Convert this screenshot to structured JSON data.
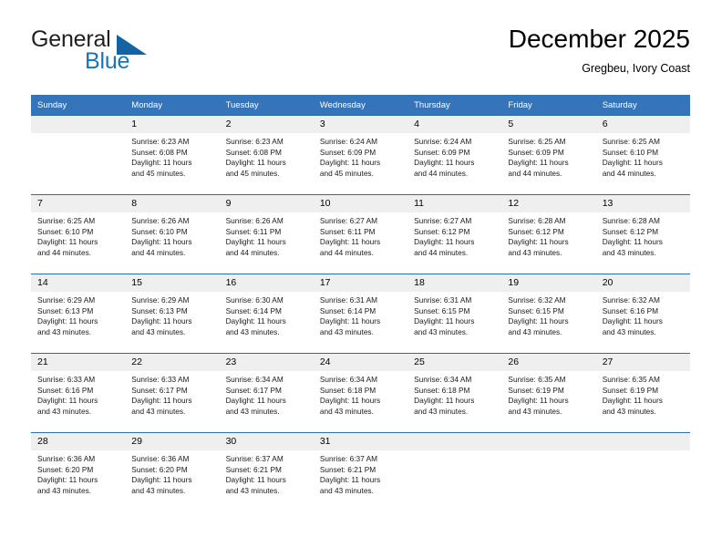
{
  "brand": {
    "name_part1": "General",
    "name_part2": "Blue",
    "accent_color": "#1675bc",
    "triangle_color": "#1464a5"
  },
  "header": {
    "title": "December 2025",
    "subtitle": "Gregbeu, Ivory Coast"
  },
  "theme": {
    "header_row_bg": "#3574b8",
    "daynum_bg": "#efefef",
    "row_divider": "#2e6da8"
  },
  "weekdays": [
    "Sunday",
    "Monday",
    "Tuesday",
    "Wednesday",
    "Thursday",
    "Friday",
    "Saturday"
  ],
  "weeks": [
    [
      {
        "day": "",
        "blank": true,
        "sunrise": "",
        "sunset": "",
        "daylight1": "",
        "daylight2": ""
      },
      {
        "day": "1",
        "blank": false,
        "sunrise": "Sunrise: 6:23 AM",
        "sunset": "Sunset: 6:08 PM",
        "daylight1": "Daylight: 11 hours",
        "daylight2": "and 45 minutes."
      },
      {
        "day": "2",
        "blank": false,
        "sunrise": "Sunrise: 6:23 AM",
        "sunset": "Sunset: 6:08 PM",
        "daylight1": "Daylight: 11 hours",
        "daylight2": "and 45 minutes."
      },
      {
        "day": "3",
        "blank": false,
        "sunrise": "Sunrise: 6:24 AM",
        "sunset": "Sunset: 6:09 PM",
        "daylight1": "Daylight: 11 hours",
        "daylight2": "and 45 minutes."
      },
      {
        "day": "4",
        "blank": false,
        "sunrise": "Sunrise: 6:24 AM",
        "sunset": "Sunset: 6:09 PM",
        "daylight1": "Daylight: 11 hours",
        "daylight2": "and 44 minutes."
      },
      {
        "day": "5",
        "blank": false,
        "sunrise": "Sunrise: 6:25 AM",
        "sunset": "Sunset: 6:09 PM",
        "daylight1": "Daylight: 11 hours",
        "daylight2": "and 44 minutes."
      },
      {
        "day": "6",
        "blank": false,
        "sunrise": "Sunrise: 6:25 AM",
        "sunset": "Sunset: 6:10 PM",
        "daylight1": "Daylight: 11 hours",
        "daylight2": "and 44 minutes."
      }
    ],
    [
      {
        "day": "7",
        "blank": false,
        "sunrise": "Sunrise: 6:25 AM",
        "sunset": "Sunset: 6:10 PM",
        "daylight1": "Daylight: 11 hours",
        "daylight2": "and 44 minutes."
      },
      {
        "day": "8",
        "blank": false,
        "sunrise": "Sunrise: 6:26 AM",
        "sunset": "Sunset: 6:10 PM",
        "daylight1": "Daylight: 11 hours",
        "daylight2": "and 44 minutes."
      },
      {
        "day": "9",
        "blank": false,
        "sunrise": "Sunrise: 6:26 AM",
        "sunset": "Sunset: 6:11 PM",
        "daylight1": "Daylight: 11 hours",
        "daylight2": "and 44 minutes."
      },
      {
        "day": "10",
        "blank": false,
        "sunrise": "Sunrise: 6:27 AM",
        "sunset": "Sunset: 6:11 PM",
        "daylight1": "Daylight: 11 hours",
        "daylight2": "and 44 minutes."
      },
      {
        "day": "11",
        "blank": false,
        "sunrise": "Sunrise: 6:27 AM",
        "sunset": "Sunset: 6:12 PM",
        "daylight1": "Daylight: 11 hours",
        "daylight2": "and 44 minutes."
      },
      {
        "day": "12",
        "blank": false,
        "sunrise": "Sunrise: 6:28 AM",
        "sunset": "Sunset: 6:12 PM",
        "daylight1": "Daylight: 11 hours",
        "daylight2": "and 43 minutes."
      },
      {
        "day": "13",
        "blank": false,
        "sunrise": "Sunrise: 6:28 AM",
        "sunset": "Sunset: 6:12 PM",
        "daylight1": "Daylight: 11 hours",
        "daylight2": "and 43 minutes."
      }
    ],
    [
      {
        "day": "14",
        "blank": false,
        "sunrise": "Sunrise: 6:29 AM",
        "sunset": "Sunset: 6:13 PM",
        "daylight1": "Daylight: 11 hours",
        "daylight2": "and 43 minutes."
      },
      {
        "day": "15",
        "blank": false,
        "sunrise": "Sunrise: 6:29 AM",
        "sunset": "Sunset: 6:13 PM",
        "daylight1": "Daylight: 11 hours",
        "daylight2": "and 43 minutes."
      },
      {
        "day": "16",
        "blank": false,
        "sunrise": "Sunrise: 6:30 AM",
        "sunset": "Sunset: 6:14 PM",
        "daylight1": "Daylight: 11 hours",
        "daylight2": "and 43 minutes."
      },
      {
        "day": "17",
        "blank": false,
        "sunrise": "Sunrise: 6:31 AM",
        "sunset": "Sunset: 6:14 PM",
        "daylight1": "Daylight: 11 hours",
        "daylight2": "and 43 minutes."
      },
      {
        "day": "18",
        "blank": false,
        "sunrise": "Sunrise: 6:31 AM",
        "sunset": "Sunset: 6:15 PM",
        "daylight1": "Daylight: 11 hours",
        "daylight2": "and 43 minutes."
      },
      {
        "day": "19",
        "blank": false,
        "sunrise": "Sunrise: 6:32 AM",
        "sunset": "Sunset: 6:15 PM",
        "daylight1": "Daylight: 11 hours",
        "daylight2": "and 43 minutes."
      },
      {
        "day": "20",
        "blank": false,
        "sunrise": "Sunrise: 6:32 AM",
        "sunset": "Sunset: 6:16 PM",
        "daylight1": "Daylight: 11 hours",
        "daylight2": "and 43 minutes."
      }
    ],
    [
      {
        "day": "21",
        "blank": false,
        "sunrise": "Sunrise: 6:33 AM",
        "sunset": "Sunset: 6:16 PM",
        "daylight1": "Daylight: 11 hours",
        "daylight2": "and 43 minutes."
      },
      {
        "day": "22",
        "blank": false,
        "sunrise": "Sunrise: 6:33 AM",
        "sunset": "Sunset: 6:17 PM",
        "daylight1": "Daylight: 11 hours",
        "daylight2": "and 43 minutes."
      },
      {
        "day": "23",
        "blank": false,
        "sunrise": "Sunrise: 6:34 AM",
        "sunset": "Sunset: 6:17 PM",
        "daylight1": "Daylight: 11 hours",
        "daylight2": "and 43 minutes."
      },
      {
        "day": "24",
        "blank": false,
        "sunrise": "Sunrise: 6:34 AM",
        "sunset": "Sunset: 6:18 PM",
        "daylight1": "Daylight: 11 hours",
        "daylight2": "and 43 minutes."
      },
      {
        "day": "25",
        "blank": false,
        "sunrise": "Sunrise: 6:34 AM",
        "sunset": "Sunset: 6:18 PM",
        "daylight1": "Daylight: 11 hours",
        "daylight2": "and 43 minutes."
      },
      {
        "day": "26",
        "blank": false,
        "sunrise": "Sunrise: 6:35 AM",
        "sunset": "Sunset: 6:19 PM",
        "daylight1": "Daylight: 11 hours",
        "daylight2": "and 43 minutes."
      },
      {
        "day": "27",
        "blank": false,
        "sunrise": "Sunrise: 6:35 AM",
        "sunset": "Sunset: 6:19 PM",
        "daylight1": "Daylight: 11 hours",
        "daylight2": "and 43 minutes."
      }
    ],
    [
      {
        "day": "28",
        "blank": false,
        "sunrise": "Sunrise: 6:36 AM",
        "sunset": "Sunset: 6:20 PM",
        "daylight1": "Daylight: 11 hours",
        "daylight2": "and 43 minutes."
      },
      {
        "day": "29",
        "blank": false,
        "sunrise": "Sunrise: 6:36 AM",
        "sunset": "Sunset: 6:20 PM",
        "daylight1": "Daylight: 11 hours",
        "daylight2": "and 43 minutes."
      },
      {
        "day": "30",
        "blank": false,
        "sunrise": "Sunrise: 6:37 AM",
        "sunset": "Sunset: 6:21 PM",
        "daylight1": "Daylight: 11 hours",
        "daylight2": "and 43 minutes."
      },
      {
        "day": "31",
        "blank": false,
        "sunrise": "Sunrise: 6:37 AM",
        "sunset": "Sunset: 6:21 PM",
        "daylight1": "Daylight: 11 hours",
        "daylight2": "and 43 minutes."
      },
      {
        "day": "",
        "blank": true,
        "sunrise": "",
        "sunset": "",
        "daylight1": "",
        "daylight2": ""
      },
      {
        "day": "",
        "blank": true,
        "sunrise": "",
        "sunset": "",
        "daylight1": "",
        "daylight2": ""
      },
      {
        "day": "",
        "blank": true,
        "sunrise": "",
        "sunset": "",
        "daylight1": "",
        "daylight2": ""
      }
    ]
  ]
}
